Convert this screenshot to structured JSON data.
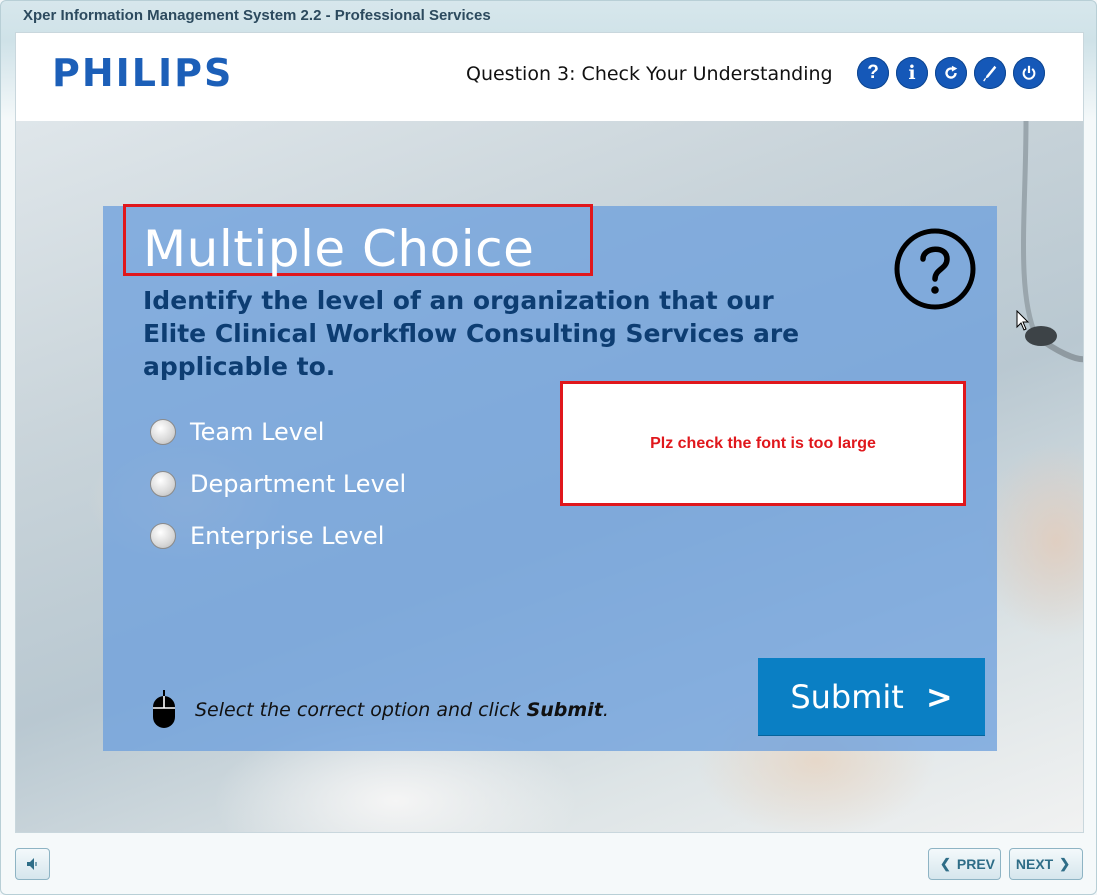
{
  "window": {
    "title": "Xper Information Management System 2.2 - Professional Services"
  },
  "header": {
    "logo": "PHILIPS",
    "question_title": "Question 3: Check Your Understanding",
    "buttons": [
      {
        "name": "help",
        "icon": "question-icon",
        "glyph": "?"
      },
      {
        "name": "info",
        "icon": "info-icon",
        "glyph": "i"
      },
      {
        "name": "replay",
        "icon": "replay-icon"
      },
      {
        "name": "pen",
        "icon": "pen-icon"
      },
      {
        "name": "exit",
        "icon": "power-icon"
      }
    ],
    "button_color": "#1558b8"
  },
  "panel": {
    "heading": "Multiple Choice",
    "question": "Identify the level of an organization that our Elite Clinical Workflow Consulting Services are applicable to.",
    "options": [
      "Team Level",
      "Department Level",
      "Enterprise Level"
    ],
    "note": "Plz check the font is too large",
    "instruction_prefix": "Select the correct option and click ",
    "instruction_bold": "Submit",
    "instruction_suffix": ".",
    "submit_label": "Submit",
    "submit_chevron": ">",
    "accent_color": "#0a7fc4",
    "annotation_color": "#e0171c"
  },
  "footer": {
    "prev_label": "PREV",
    "next_label": "NEXT",
    "volume_icon": "speaker-icon"
  }
}
